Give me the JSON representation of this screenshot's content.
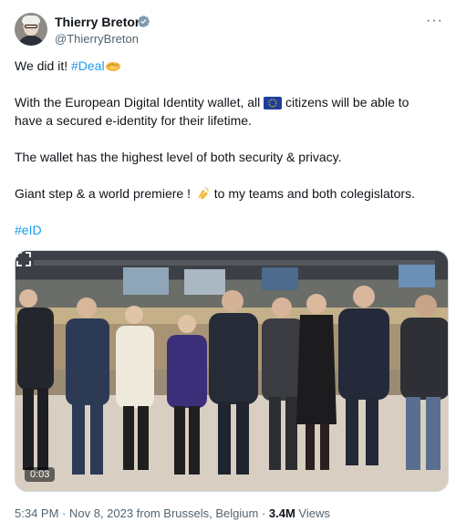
{
  "author": {
    "name": "Thierry Breton",
    "handle": "@ThierryBreton"
  },
  "menu": {
    "more_label": "···"
  },
  "tweet": {
    "line1_text": "We did it! ",
    "line1_hashtag": "#Deal",
    "line2_a": "With the European Digital Identity wallet, all ",
    "line2_b": " citizens will be able to",
    "line3": "have a secured e-identity for their lifetime.",
    "line4": "The wallet has the highest level of both security & privacy.",
    "line5_a": "Giant step & a world premiere ! ",
    "line5_b": " to my teams and both colegislators.",
    "hashtag2": "#eID"
  },
  "media": {
    "video_time": "0:03"
  },
  "meta": {
    "time_location": "5:34 PM · Nov 8, 2023 from Brussels, Belgium · ",
    "views_count": "3.4M",
    "views_label": " Views"
  },
  "colors": {
    "link": "#1d9bf0",
    "verified": "#829aab",
    "text": "#0f1419",
    "secondary": "#536471"
  }
}
